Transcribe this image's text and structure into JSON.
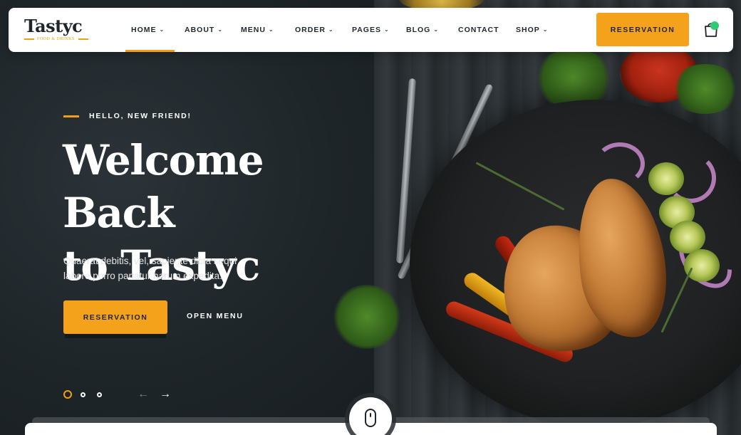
{
  "brand": {
    "name": "Tastyc",
    "tagline": "FOOD & DRINKS",
    "accent_color": "#f4a11b"
  },
  "nav": {
    "items": [
      {
        "label": "HOME",
        "has_dropdown": true,
        "active": true
      },
      {
        "label": "ABOUT",
        "has_dropdown": true,
        "active": false
      },
      {
        "label": "MENU",
        "has_dropdown": true,
        "active": false
      },
      {
        "label": "ORDER",
        "has_dropdown": true,
        "active": false
      },
      {
        "label": "PAGES",
        "has_dropdown": true,
        "active": false
      },
      {
        "label": "BLOG",
        "has_dropdown": true,
        "active": false
      },
      {
        "label": "CONTACT",
        "has_dropdown": false,
        "active": false
      },
      {
        "label": "SHOP",
        "has_dropdown": true,
        "active": false
      }
    ],
    "chevron": "⌄",
    "reservation_label": "RESERVATION",
    "cart_icon": "shopping-bag-icon",
    "cart_badge_color": "#2ecb74"
  },
  "hero": {
    "kicker": "HELLO, NEW FRIEND!",
    "title_line1": "Welcome Back",
    "title_line2": "to Tastyc",
    "description": "Quaerat debitis, vel, sapiente dicta sequi labore porro pariatur harum expedita.",
    "primary_button": "RESERVATION",
    "secondary_button": "OPEN MENU"
  },
  "slider": {
    "slide_count": 3,
    "active_slide": 1,
    "prev_icon": "←",
    "next_icon": "→"
  },
  "scroll": {
    "icon": "mouse-icon"
  }
}
